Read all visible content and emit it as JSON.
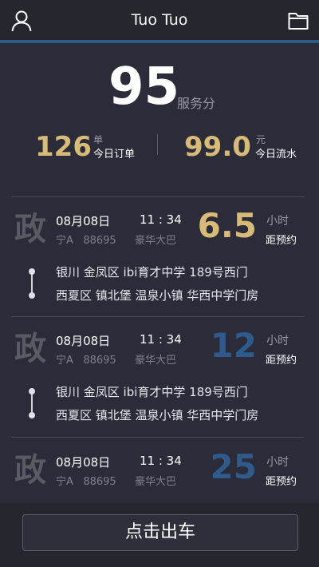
{
  "header": {
    "title": "Tuo Tuo",
    "left_icon": "user-icon",
    "right_icon": "folder-icon"
  },
  "summary": {
    "score": "95",
    "score_label": "服务分",
    "orders_value": "126",
    "orders_unit": "单",
    "orders_label": "今日订单",
    "revenue_value": "99.0",
    "revenue_unit": "元",
    "revenue_label": "今日流水"
  },
  "orders": [
    {
      "badge": "政",
      "date": "08月08日",
      "time": "11 : 34",
      "plate_prefix": "宁A",
      "plate_number": "88695",
      "vehicle": "豪华大巴",
      "hours": "6.5",
      "hours_color": "#d9bb78",
      "hours_unit": "小时",
      "hours_label": "距预约",
      "from": "银川 金凤区 ibi育才中学 189号西门",
      "to": "西夏区 镇北堡 温泉小镇 华西中学门房"
    },
    {
      "badge": "政",
      "date": "08月08日",
      "time": "11 : 34",
      "plate_prefix": "宁A",
      "plate_number": "88695",
      "vehicle": "豪华大巴",
      "hours": "12",
      "hours_color": "#2f5a8c",
      "hours_unit": "小时",
      "hours_label": "距预约",
      "from": "银川 金凤区 ibi育才中学 189号西门",
      "to": "西夏区 镇北堡 温泉小镇 华西中学门房"
    },
    {
      "badge": "政",
      "date": "08月08日",
      "time": "11 : 34",
      "plate_prefix": "宁A",
      "plate_number": "88695",
      "vehicle": "豪华大巴",
      "hours": "25",
      "hours_color": "#2f5a8c",
      "hours_unit": "小时",
      "hours_label": "距预约",
      "from": "",
      "to": ""
    }
  ],
  "bottom": {
    "go_label": "点击出车"
  }
}
